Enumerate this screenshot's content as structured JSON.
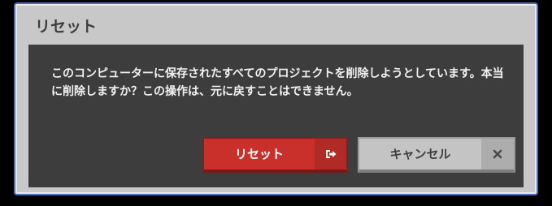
{
  "dialog": {
    "title": "リセット",
    "message": "このコンピューターに保存されたすべてのプロジェクトを削除しようとしています。本当に削除しますか？この操作は、元に戻すことはできません。"
  },
  "buttons": {
    "reset": {
      "label": "リセット",
      "icon": "sign-out-icon",
      "color": "#c9302c"
    },
    "cancel": {
      "label": "キャンセル",
      "icon": "close-icon",
      "color": "#c4c4c4"
    }
  }
}
